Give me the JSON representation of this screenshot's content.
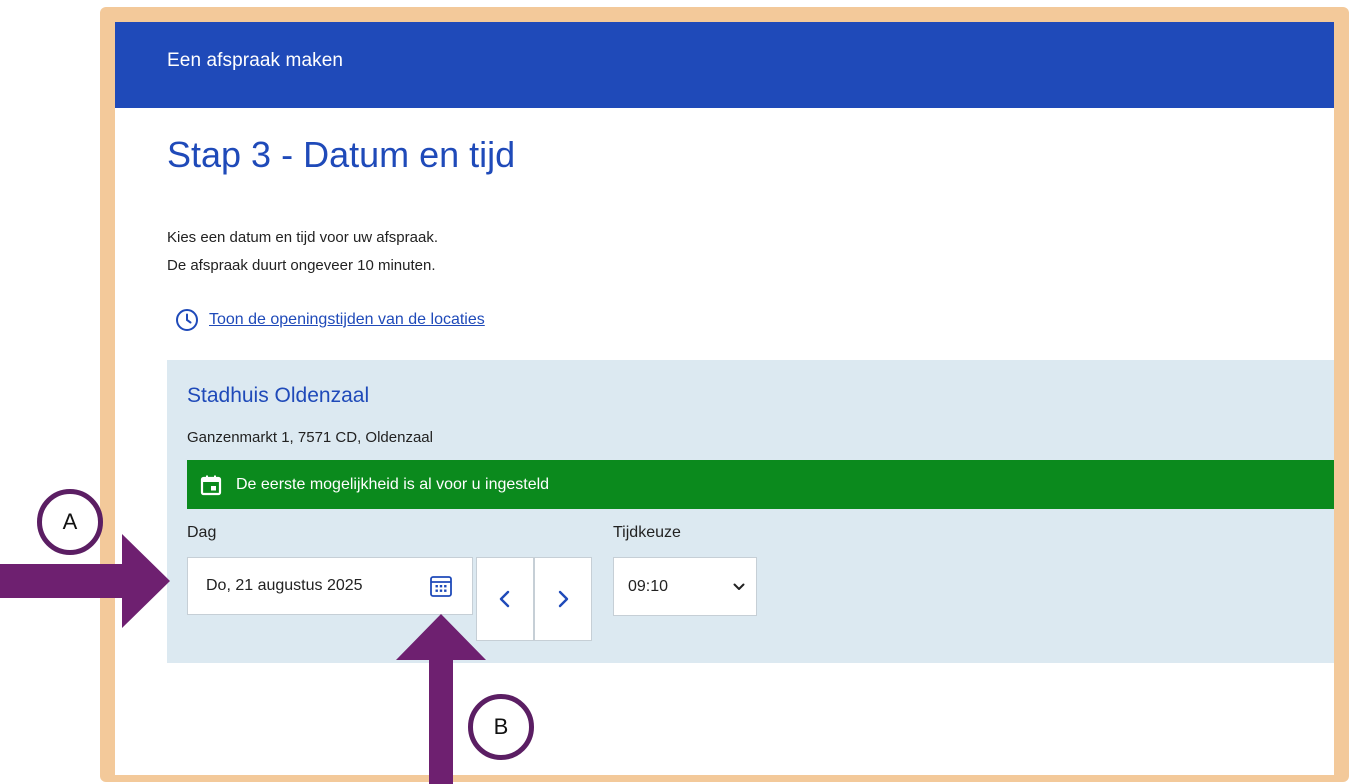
{
  "header": {
    "title": "Een afspraak maken"
  },
  "page": {
    "title": "Stap 3 - Datum en tijd",
    "intro_lines": [
      "Kies een datum en tijd voor uw afspraak.",
      "De afspraak duurt ongeveer 10 minuten."
    ],
    "opening_hours_link": "Toon de openingstijden van de locaties"
  },
  "location": {
    "name": "Stadhuis Oldenzaal",
    "address": "Ganzenmarkt 1, 7571 CD, Oldenzaal",
    "notice": "De eerste mogelijkheid is al voor u ingesteld",
    "day_label": "Dag",
    "day_value": "Do, 21 augustus 2025",
    "time_label": "Tijdkeuze",
    "time_value": "09:10"
  },
  "annotations": {
    "badge_a": "A",
    "badge_b": "B"
  },
  "colors": {
    "primary": "#1f4ab9",
    "notice_green": "#0b8a1d",
    "panel": "#dce9f1",
    "frame": "#f3c99a",
    "arrow": "#6e2070"
  },
  "icons": {
    "clock": "clock-icon",
    "calendar_notice": "calendar-icon",
    "calendar_picker": "calendar-grid-icon",
    "previous": "chevron-left-icon",
    "next": "chevron-right-icon",
    "dropdown": "chevron-down-icon"
  }
}
